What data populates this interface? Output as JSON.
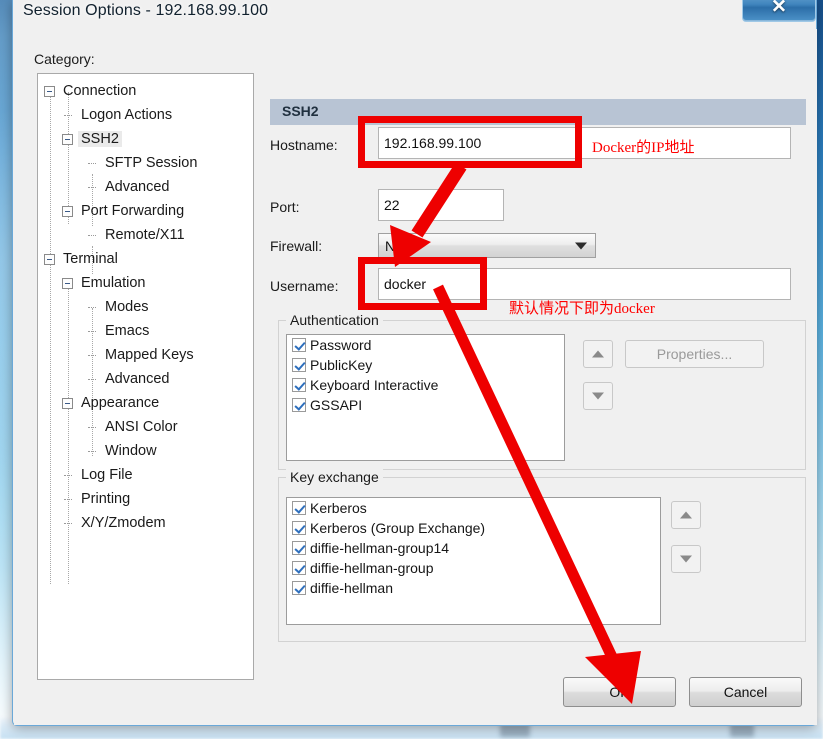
{
  "window": {
    "title": "Session Options - 192.168.99.100",
    "close_icon": "close-icon",
    "close_glyph": "✕"
  },
  "category": {
    "label": "Category:",
    "selected": "SSH2",
    "items": [
      {
        "label": "Connection",
        "indent": 0,
        "type": "expander",
        "expanded": true,
        "selected": false
      },
      {
        "label": "Logon Actions",
        "indent": 1,
        "type": "leaf",
        "expanded": false,
        "selected": false
      },
      {
        "label": "SSH2",
        "indent": 1,
        "type": "expander",
        "expanded": true,
        "selected": true
      },
      {
        "label": "SFTP Session",
        "indent": 2,
        "type": "leaf",
        "expanded": false,
        "selected": false
      },
      {
        "label": "Advanced",
        "indent": 2,
        "type": "leaf",
        "expanded": false,
        "selected": false
      },
      {
        "label": "Port Forwarding",
        "indent": 1,
        "type": "expander",
        "expanded": true,
        "selected": false
      },
      {
        "label": "Remote/X11",
        "indent": 2,
        "type": "leaf",
        "expanded": false,
        "selected": false
      },
      {
        "label": "Terminal",
        "indent": 0,
        "type": "expander",
        "expanded": true,
        "selected": false
      },
      {
        "label": "Emulation",
        "indent": 1,
        "type": "expander",
        "expanded": true,
        "selected": false
      },
      {
        "label": "Modes",
        "indent": 2,
        "type": "leaf",
        "expanded": false,
        "selected": false
      },
      {
        "label": "Emacs",
        "indent": 2,
        "type": "leaf",
        "expanded": false,
        "selected": false
      },
      {
        "label": "Mapped Keys",
        "indent": 2,
        "type": "leaf",
        "expanded": false,
        "selected": false
      },
      {
        "label": "Advanced",
        "indent": 2,
        "type": "leaf",
        "expanded": false,
        "selected": false
      },
      {
        "label": "Appearance",
        "indent": 1,
        "type": "expander",
        "expanded": true,
        "selected": false
      },
      {
        "label": "ANSI Color",
        "indent": 2,
        "type": "leaf",
        "expanded": false,
        "selected": false
      },
      {
        "label": "Window",
        "indent": 2,
        "type": "leaf",
        "expanded": false,
        "selected": false
      },
      {
        "label": "Log File",
        "indent": 1,
        "type": "leaf",
        "expanded": false,
        "selected": false
      },
      {
        "label": "Printing",
        "indent": 1,
        "type": "leaf",
        "expanded": false,
        "selected": false
      },
      {
        "label": "X/Y/Zmodem",
        "indent": 1,
        "type": "leaf",
        "expanded": false,
        "selected": false
      }
    ]
  },
  "panel": {
    "header": "SSH2",
    "fields": {
      "hostname_label": "Hostname:",
      "hostname_value": "192.168.99.100",
      "port_label": "Port:",
      "port_value": "22",
      "firewall_label": "Firewall:",
      "firewall_value": "None",
      "username_label": "Username:",
      "username_value": "docker"
    },
    "authentication": {
      "title": "Authentication",
      "items": [
        {
          "label": "Password",
          "checked": true
        },
        {
          "label": "PublicKey",
          "checked": true
        },
        {
          "label": "Keyboard Interactive",
          "checked": true
        },
        {
          "label": "GSSAPI",
          "checked": true
        }
      ],
      "properties_button": "Properties...",
      "move_up_icon": "arrow-up-icon",
      "move_down_icon": "arrow-down-icon"
    },
    "key_exchange": {
      "title": "Key exchange",
      "items": [
        {
          "label": "Kerberos",
          "checked": true
        },
        {
          "label": "Kerberos (Group Exchange)",
          "checked": true
        },
        {
          "label": "diffie-hellman-group14",
          "checked": true
        },
        {
          "label": "diffie-hellman-group",
          "checked": true
        },
        {
          "label": "diffie-hellman",
          "checked": true
        }
      ],
      "move_up_icon": "arrow-up-icon",
      "move_down_icon": "arrow-down-icon"
    }
  },
  "footer": {
    "ok_label": "OK",
    "cancel_label": "Cancel"
  },
  "annotations": {
    "accent_color": "#ee0000",
    "hostname_note": "Docker的IP地址",
    "username_note": "默认情况下即为docker"
  }
}
